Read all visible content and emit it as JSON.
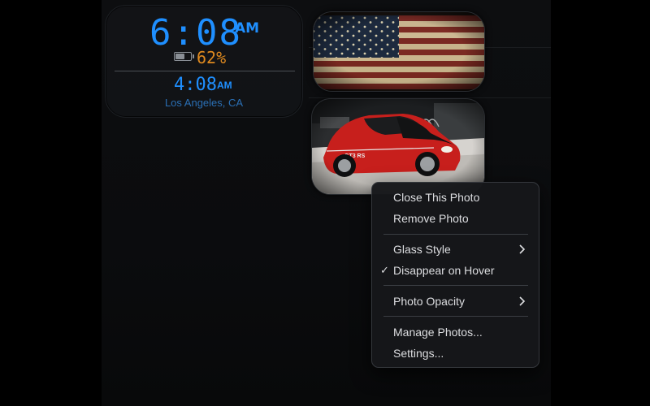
{
  "clock": {
    "time": "6:08",
    "ampm": "AM",
    "battery": "62%",
    "second_time": "4:08",
    "second_ampm": "AM",
    "second_city": "Los Angeles, CA"
  },
  "photos": [
    {
      "subject": "american-flag"
    },
    {
      "subject": "red-sports-car"
    }
  ],
  "context_menu": {
    "items": [
      {
        "label": "Close This Photo"
      },
      {
        "label": "Remove Photo"
      },
      {
        "label": "Glass Style",
        "submenu": true
      },
      {
        "label": "Disappear on Hover",
        "checked": true
      },
      {
        "label": "Photo Opacity",
        "submenu": true
      },
      {
        "label": "Manage Photos..."
      },
      {
        "label": "Settings..."
      }
    ],
    "check_glyph": "✓"
  },
  "colors": {
    "clock_blue": "#1f8fff",
    "battery_orange": "#e08a1f",
    "menu_text": "#dcdde0"
  }
}
